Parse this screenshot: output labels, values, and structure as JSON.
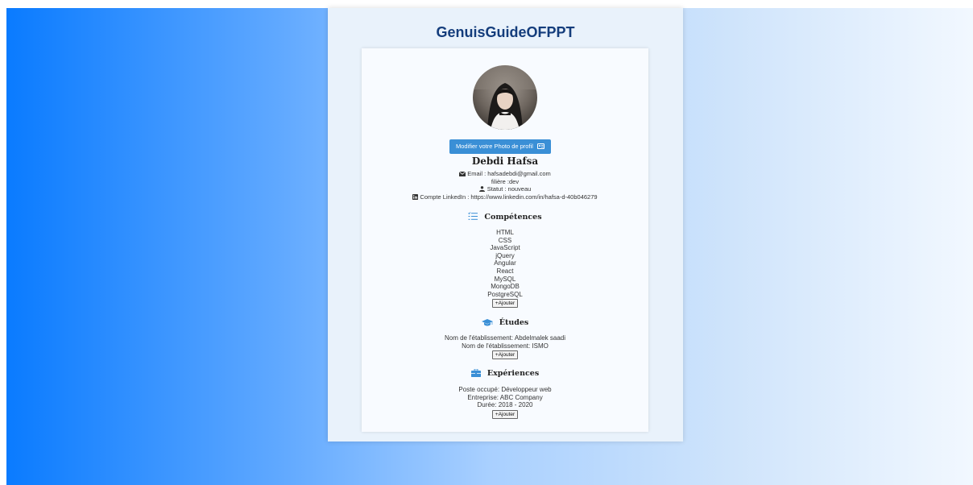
{
  "site_title": "GenuisGuideOFPPT",
  "profile": {
    "photo_button_label": "Modifier votre Photo de profil",
    "name": "Debdi Hafsa",
    "email_line": "Email : hafsadebdi@gmail.com",
    "filiere_line": "filière :dev",
    "statut_line": "Statut : nouveau",
    "linkedin_line": "Compte LinkedIn : https://www.linkedin.com/in/hafsa-d-40b046279"
  },
  "competences": {
    "title": "Compétences",
    "items": [
      "HTML",
      "CSS",
      "JavaScript",
      "jQuery",
      "Angular",
      "React",
      "MySQL",
      "MongoDB",
      "PostgreSQL"
    ],
    "add_label": "Ajouter"
  },
  "etudes": {
    "title": "Études",
    "items": [
      "Nom de l'établissement: Abdelmalek saadi",
      "Nom de l'établissement: ISMO"
    ],
    "add_label": "Ajouter"
  },
  "experiences": {
    "title": "Expériences",
    "items": [
      "Poste occupé: Développeur web",
      "Entreprise: ABC Company",
      "Durée: 2018 - 2020"
    ],
    "add_label": "Ajouter"
  },
  "icons": {
    "email": "envelope-icon",
    "statut": "user-icon",
    "linkedin": "linkedin-icon",
    "photo": "id-card-icon",
    "competences": "list-check-icon",
    "etudes": "graduation-cap-icon",
    "experiences": "briefcase-icon",
    "add": "plus-icon"
  },
  "colors": {
    "accent": "#3a8fd6",
    "title": "#143d7c",
    "gradient_start": "#0a7bff",
    "gradient_end": "#f2f8ff"
  }
}
